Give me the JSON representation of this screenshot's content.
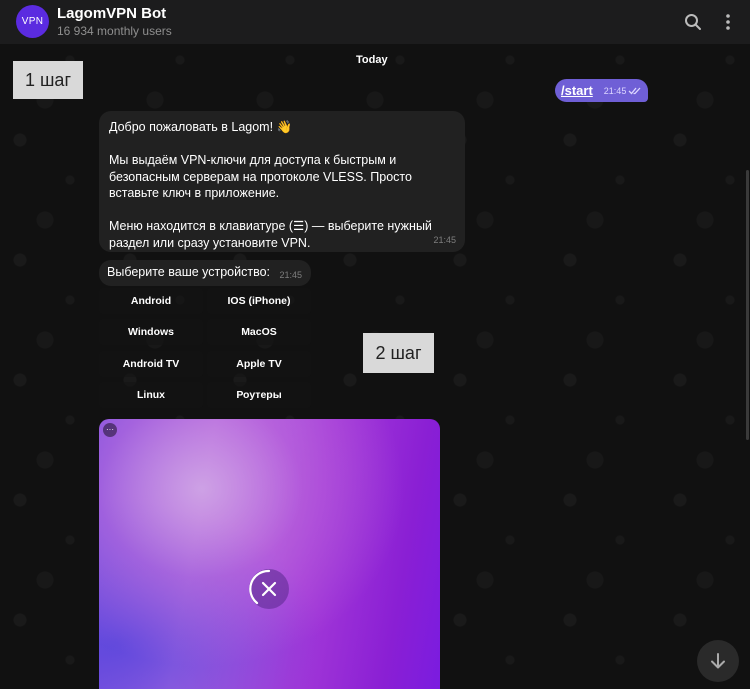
{
  "header": {
    "avatar_text": "VPN",
    "title": "LagomVPN Bot",
    "subtitle": "16 934 monthly users",
    "icons": [
      "search-icon",
      "more-vertical-icon"
    ]
  },
  "chat": {
    "date_label": "Today",
    "step_labels": [
      "1 шаг",
      "2 шаг"
    ],
    "outgoing": {
      "text": "/start",
      "time": "21:45",
      "status_icon": "double-check-icon"
    },
    "welcome": {
      "line1": "Добро пожаловать в Lagom! 👋",
      "para2_line1": "Мы выдаём VPN-ключи для доступа к быстрым и",
      "para2_line2": "безопасным серверам на протоколе VLESS. Просто",
      "para2_line3": "вставьте ключ в приложение.",
      "para3_line1": "Меню находится в клавиатуре (☰) — выберите нужный",
      "para3_line2": "раздел или сразу установите VPN.",
      "time": "21:45"
    },
    "device_prompt": {
      "text": "Выберите ваше устройство:",
      "time": "21:45"
    },
    "keyboard": [
      [
        "Android",
        "IOS (iPhone)"
      ],
      [
        "Windows",
        "MacOS"
      ],
      [
        "Android TV",
        "Apple TV"
      ],
      [
        "Linux",
        "Роутеры"
      ]
    ],
    "media": {
      "more_label": "···",
      "cancel_icon": "close-icon"
    }
  },
  "scroll_down_icon": "arrow-down-icon",
  "colors": {
    "accent": "#6f5fd6",
    "avatar": "#5b2be0",
    "bubble": "#212121"
  }
}
